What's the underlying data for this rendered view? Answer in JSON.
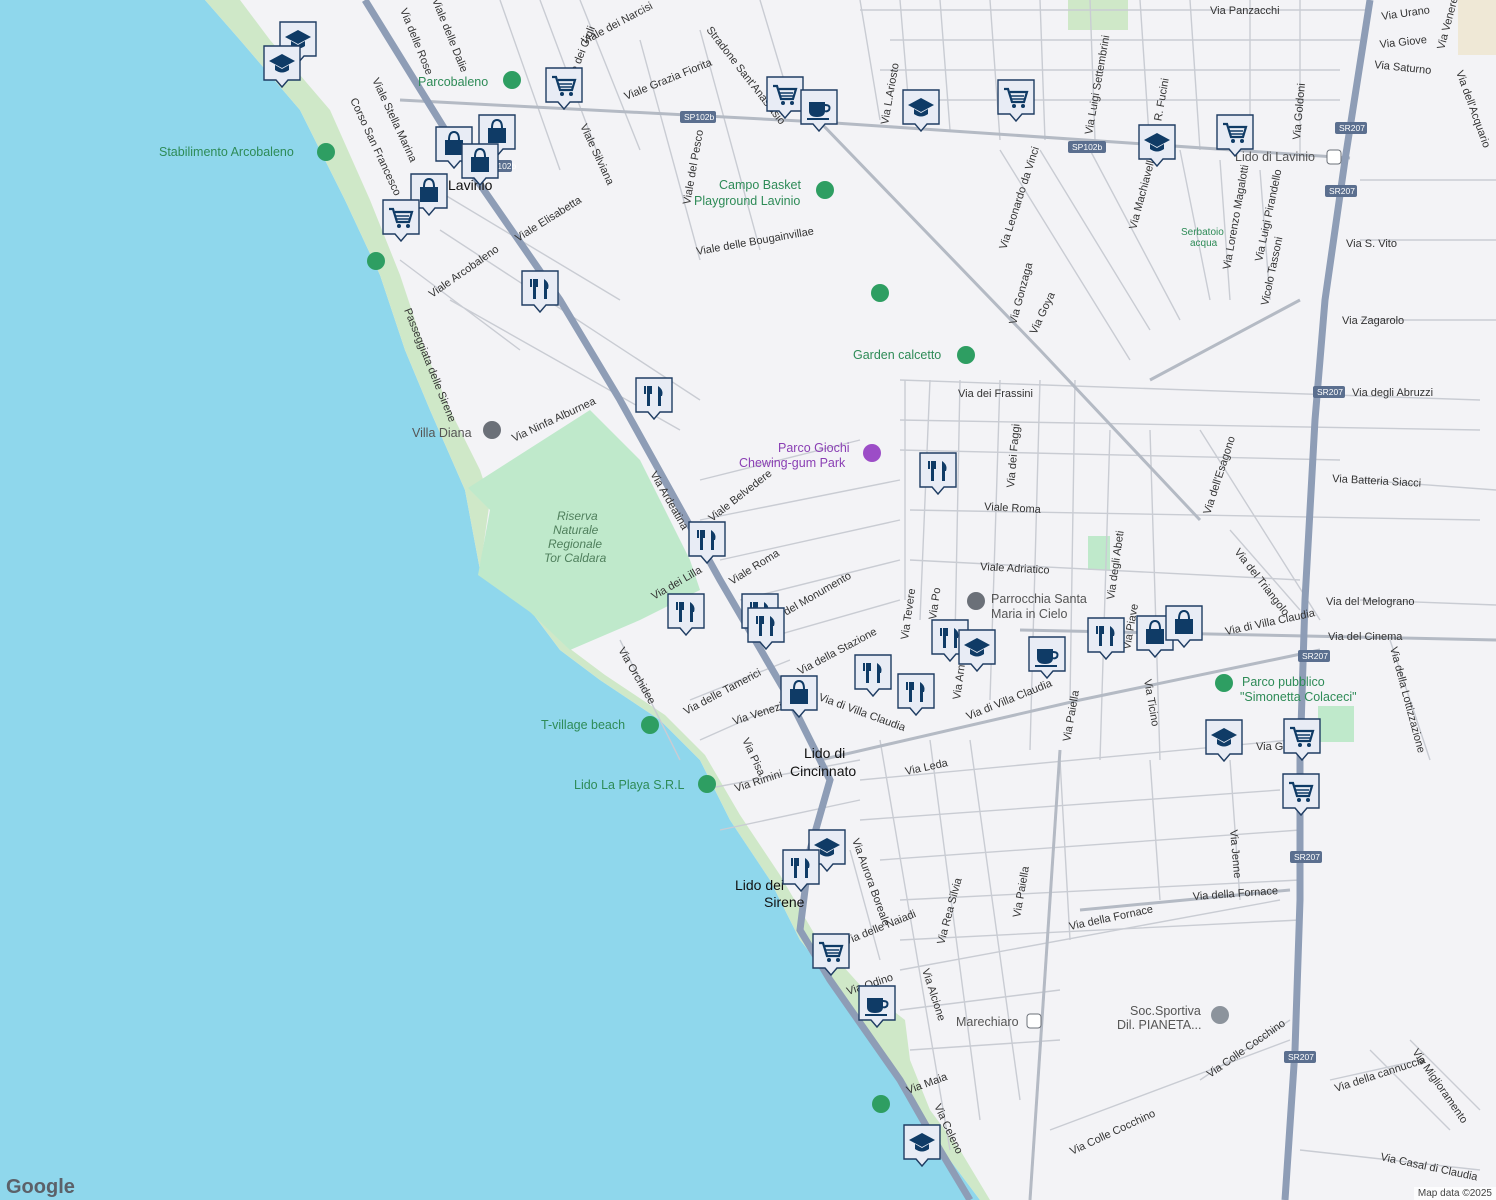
{
  "attribution": "Map data ©2025",
  "logo": "Google",
  "towns": [
    {
      "id": "lavinio",
      "label": "Lavinio"
    },
    {
      "id": "cincinnato-1",
      "label": "Lido di"
    },
    {
      "id": "cincinnato-2",
      "label": "Cincinnato"
    },
    {
      "id": "sirene-1",
      "label": "Lido dei"
    },
    {
      "id": "sirene-2",
      "label": "Sirene"
    }
  ],
  "places": {
    "parcobaleno": "Parcobaleno",
    "arcobaleno": "Stabilimento Arcobaleno",
    "basket1": "Campo Basket",
    "basket2": "Playground Lavinio",
    "calcetto": "Garden calcetto",
    "villa_diana": "Villa Diana",
    "giochi1": "Parco Giochi",
    "giochi2": "Chewing-gum Park",
    "riserva1": "Riserva",
    "riserva2": "Naturale",
    "riserva3": "Regionale",
    "riserva4": "Tor Caldara",
    "parrocchia1": "Parrocchia Santa",
    "parrocchia2": "Maria in Cielo",
    "tvillage": "T-village beach",
    "laplaya": "Lido La Playa S.R.L",
    "pubblico1": "Parco pubblico",
    "pubblico2": "\"Simonetta Colaceci\"",
    "serbatoio1": "Serbatoio",
    "serbatoio2": "acqua",
    "lido_lavinio": "Lido di Lavinio",
    "marechiaro": "Marechiaro",
    "soc1": "Soc.Sportiva",
    "soc2": "Dil. PIANETA..."
  },
  "road_shields": [
    "SP102b",
    "SP102b",
    "SP102b",
    "SR207",
    "SR207",
    "SR207",
    "SR207",
    "SR207",
    "SR207"
  ],
  "streets": [
    "Via delle Rose",
    "Viale delle Dalie",
    "Viale dei Narcisi",
    "Viale dei Gigli",
    "Viale Grazia Fiorita",
    "Stradone Sant'Anastasio",
    "Via L.Ariosto",
    "Via Luigi Settembrini",
    "Via Panzacchi",
    "Via Urano",
    "Via Giove",
    "Via Saturno",
    "Via dell'Acquario",
    "Via Venere",
    "Viale Stella Marina",
    "Corso San Francesco",
    "Viale Silviana",
    "Viale del Pesco",
    "Viale Elisabetta",
    "Viale delle Bougainvillae",
    "Via Leonardo da Vinci",
    "Via Machiavelli",
    "Via R. Fucini",
    "Via Gonzaga",
    "Via Goya",
    "Via Lorenzo Magalotti",
    "Via Luigi Pirandello",
    "Vicolo Tassoni",
    "Via Goldoni",
    "Via S. Vito",
    "Via Zagarolo",
    "Viale Arcobaleno",
    "Passeggiata delle Sirene",
    "Via Ninfa Alburnea",
    "Via dei Frassini",
    "Via degli Abruzzi",
    "Via Batteria Siacci",
    "Via Ardeatina",
    "Viale Belvedere",
    "Viale Roma",
    "Viale Roma",
    "Via dei Lilla",
    "Viale Adriatico",
    "Via del Melograno",
    "Via del Cinema",
    "Via del Triangolo",
    "Via dell'Esagono",
    "Via degli Abeti",
    "Via dei Faggi",
    "Via Tevere",
    "Via Po",
    "Via Arno",
    "Via della Stazione",
    "Via del Monumento",
    "Via delle Tamerici",
    "Via Venezia",
    "Via di Villa Claudia",
    "Via di Villa Claudia",
    "Via di Villa Claudia",
    "Via Orchidee",
    "Via Pisa",
    "Via Rimini",
    "Via Leda",
    "Via Paiella",
    "Via Paiella",
    "Via Ticino",
    "Via Piave",
    "Via Jenne",
    "Via della Lottizzazione",
    "Via Aurora Boreale",
    "Via Rea Silvia",
    "Via delle Naiadi",
    "Via Odino",
    "Via Alcione",
    "Via della Fornace",
    "Via della Fornace",
    "Via Colle Cocchino",
    "Via Colle Cocchino",
    "Via della cannuccia",
    "Via Miglioramento",
    "Via Maia",
    "Via Celeno",
    "Via Casal di Claudia",
    "Via Grazie"
  ],
  "poi_pins": [
    {
      "icon": "school"
    },
    {
      "icon": "school"
    },
    {
      "icon": "shopping-cart"
    },
    {
      "icon": "shopping-cart"
    },
    {
      "icon": "cafe"
    },
    {
      "icon": "school"
    },
    {
      "icon": "shopping-cart"
    },
    {
      "icon": "school"
    },
    {
      "icon": "shopping-cart"
    },
    {
      "icon": "shopping-bag"
    },
    {
      "icon": "shopping-bag"
    },
    {
      "icon": "shopping-bag"
    },
    {
      "icon": "shopping-bag"
    },
    {
      "icon": "shopping-cart"
    },
    {
      "icon": "restaurant"
    },
    {
      "icon": "restaurant"
    },
    {
      "icon": "restaurant"
    },
    {
      "icon": "restaurant"
    },
    {
      "icon": "restaurant"
    },
    {
      "icon": "restaurant"
    },
    {
      "icon": "restaurant"
    },
    {
      "icon": "shopping-bag"
    },
    {
      "icon": "restaurant"
    },
    {
      "icon": "restaurant"
    },
    {
      "icon": "restaurant"
    },
    {
      "icon": "school"
    },
    {
      "icon": "cafe"
    },
    {
      "icon": "restaurant"
    },
    {
      "icon": "shopping-bag"
    },
    {
      "icon": "shopping-bag"
    },
    {
      "icon": "school"
    },
    {
      "icon": "shopping-cart"
    },
    {
      "icon": "shopping-cart"
    },
    {
      "icon": "school"
    },
    {
      "icon": "restaurant"
    },
    {
      "icon": "shopping-cart"
    },
    {
      "icon": "cafe"
    },
    {
      "icon": "school"
    }
  ],
  "colors": {
    "sea": "#8fd7ec",
    "land": "#f3f3f6",
    "beach": "#cfe8c8",
    "park": "#bfe9cb",
    "pin": "#0f3b66",
    "green_label": "#2e8b57",
    "purple_label": "#8a3fb4"
  }
}
